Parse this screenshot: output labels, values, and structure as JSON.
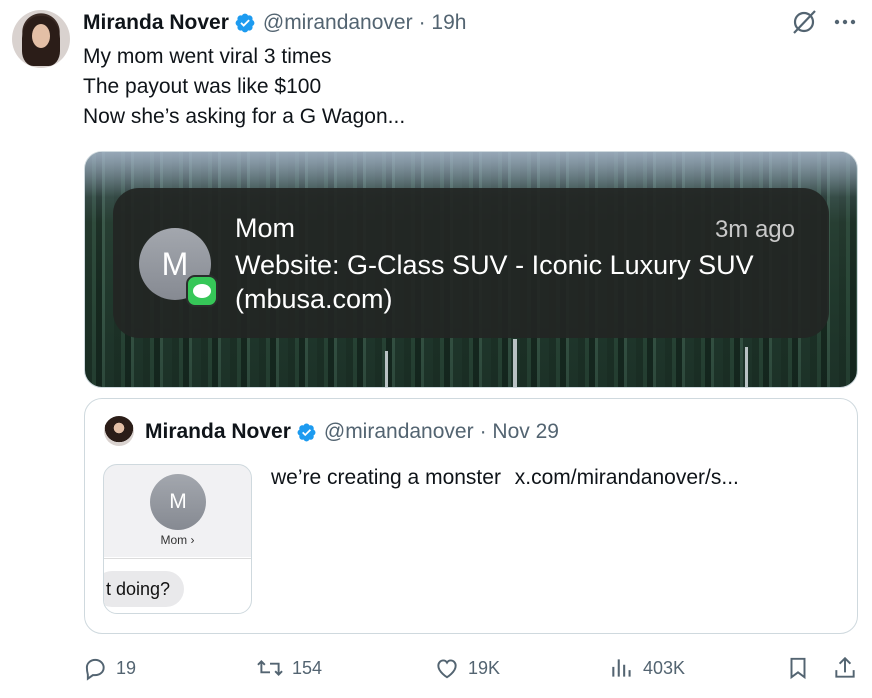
{
  "tweet": {
    "author_name": "Miranda Nover",
    "handle": "@mirandanover",
    "time": "· 19h",
    "lines": [
      "My mom went viral 3 times",
      "The payout was like $100",
      "Now she’s asking for a G Wagon..."
    ]
  },
  "notification": {
    "avatar_letter": "M",
    "sender": "Mom",
    "time": "3m ago",
    "body_line1": "Website: G-Class SUV - Iconic Luxury SUV",
    "body_line2": "(mbusa.com)"
  },
  "quote": {
    "author_name": "Miranda Nover",
    "handle": "@mirandanover",
    "date": "· Nov 29",
    "text": "we’re creating a monster",
    "link": "x.com/mirandanover/s...",
    "thumb": {
      "avatar_letter": "M",
      "contact_label": "Mom ›",
      "bubble_text": "t doing?"
    }
  },
  "actions": {
    "replies": "19",
    "reposts": "154",
    "likes": "19K",
    "views": "403K"
  },
  "icons": [
    "verified-badge-icon",
    "grok-icon",
    "more-icon",
    "reply-icon",
    "repost-icon",
    "like-icon",
    "views-icon",
    "bookmark-icon",
    "share-icon",
    "message-icon"
  ],
  "colors": {
    "accent": "#1d9bf0",
    "muted": "#536471",
    "imessage_green": "#36c758"
  }
}
